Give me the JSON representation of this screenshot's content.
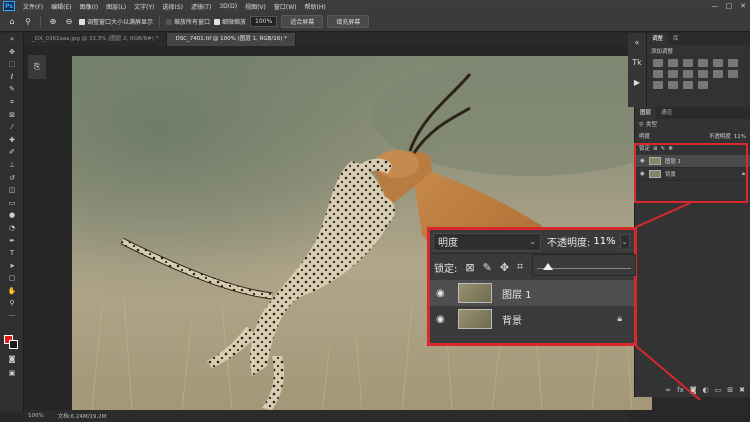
{
  "app": {
    "logo": "Ps"
  },
  "menu": [
    "文件(F)",
    "编辑(E)",
    "图像(I)",
    "图层(L)",
    "文字(Y)",
    "选择(S)",
    "滤镜(T)",
    "3D(D)",
    "视图(V)",
    "窗口(W)",
    "帮助(H)"
  ],
  "window_controls": [
    "—",
    "□",
    "✕"
  ],
  "options": {
    "resize_windows": "调整窗口大小以满屏显示",
    "zoom_all": "缩放所有窗口",
    "scrubby_zoom": "细微缩放",
    "zoom_value": "100%",
    "fit_screen": "适合屏幕",
    "fill_screen": "填充屏幕"
  },
  "tabs": [
    {
      "label": "_DX_0361aaa.jpg @ 33.3% (图层 2, RGB/8#) *",
      "active": false
    },
    {
      "label": "DSC_7401.tif @ 100% (图层 1, RGB/16) *",
      "active": true
    }
  ],
  "adjustments": {
    "tabs": [
      "调整",
      "库"
    ],
    "add_label": "添加调整"
  },
  "layers_panel": {
    "tabs": [
      "图层",
      "通道"
    ],
    "kind": "类型",
    "blend_mode": "明度",
    "opacity_label": "不透明度",
    "opacity": "11%",
    "lock_label": "锁定",
    "layers": [
      {
        "name": "图层 1",
        "selected": true
      },
      {
        "name": "背景",
        "selected": false,
        "locked": true
      }
    ]
  },
  "callout": {
    "blend_mode": "明度",
    "opacity_label": "不透明度:",
    "opacity": "11%",
    "lock_label": "锁定:",
    "layers": [
      {
        "name": "图层 1",
        "selected": true
      },
      {
        "name": "背景",
        "selected": false,
        "locked": true
      }
    ]
  },
  "status": {
    "zoom": "100%",
    "doc": "文档:6.24M/19.2M"
  },
  "colors": {
    "highlight": "#d9282c",
    "foreground": "#e21b1b",
    "background": "#1c1c1c"
  }
}
